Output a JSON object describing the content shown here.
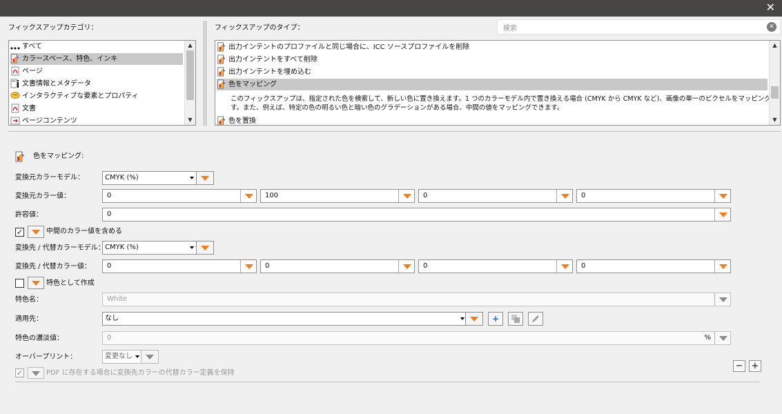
{
  "window": {
    "close_label": "✕"
  },
  "categories": {
    "label": "フィックスアップカテゴリ：",
    "items": [
      {
        "label": "すべて",
        "icon": "ellipsis-icon",
        "selected": false
      },
      {
        "label": "カラースペース、特色、インキ",
        "icon": "color-fixup-icon",
        "selected": true
      },
      {
        "label": "ページ",
        "icon": "pdf-page-icon",
        "selected": false
      },
      {
        "label": "文書情報とメタデータ",
        "icon": "info-doc-icon",
        "selected": false
      },
      {
        "label": "インタラクティブな要素とプロパティ",
        "icon": "comment-icon",
        "selected": false
      },
      {
        "label": "文書",
        "icon": "pdf-doc-icon",
        "selected": false
      },
      {
        "label": "ページコンテンツ",
        "icon": "page-content-icon",
        "selected": false
      }
    ]
  },
  "types": {
    "label": "フィックスアップのタイプ：",
    "search_placeholder": "検索",
    "items": [
      {
        "label": "出力インテントのプロファイルと同じ場合に、ICC ソースプロファイルを削除",
        "icon": "color-fixup-icon",
        "selected": false
      },
      {
        "label": "出力インテントをすべて削除",
        "icon": "color-fixup-icon",
        "selected": false
      },
      {
        "label": "出力インテントを埋め込む",
        "icon": "color-fixup-icon",
        "selected": false
      },
      {
        "label": "色をマッピング",
        "icon": "color-fixup-icon",
        "selected": true
      },
      {
        "label": "色を置換",
        "icon": "color-fixup-icon",
        "selected": false
      }
    ],
    "description_line1": "このフィックスアップは、指定された色を検索して、新しい色に置き換えます。1 つのカラーモデル内で置き換える場合 (CMYK から CMYK など)、画像の単一のピクセルをマッピングできま",
    "description_line2": "す。また、例えば、特定の色の明るい色と暗い色のグラデーションがある場合、中間の値をマッピングできます。"
  },
  "details": {
    "heading": "色をマッピング:",
    "source_model_label": "変換元カラーモデル：",
    "source_model_value": "CMYK (%)",
    "source_values_label": "変換元カラー値：",
    "source_values": [
      "0",
      "100",
      "0",
      "0"
    ],
    "tolerance_label": "許容値：",
    "tolerance_value": "0",
    "include_intermediate_label": "中間のカラー値を含める",
    "include_intermediate_checked": "✓",
    "dest_model_label": "変換先 / 代替カラーモデル：",
    "dest_model_value": "CMYK (%)",
    "dest_values_label": "変換先 / 代替カラー値：",
    "dest_values": [
      "0",
      "0",
      "0",
      "0"
    ],
    "create_spot_label": "特色として作成",
    "spot_name_label": "特色名：",
    "spot_name_value": "White",
    "apply_to_label": "適用先：",
    "apply_to_value": "なし",
    "spot_tint_label": "特色の濃淡値：",
    "spot_tint_value": "0",
    "spot_tint_unit": "%",
    "overprint_label": "オーバープリント：",
    "overprint_value": "変更なし",
    "keep_alt_label": "PDF に存在する場合に変換先カラーの代替カラー定義を保持",
    "keep_alt_checked": "✓",
    "minus_label": "−",
    "plus_label": "+"
  }
}
